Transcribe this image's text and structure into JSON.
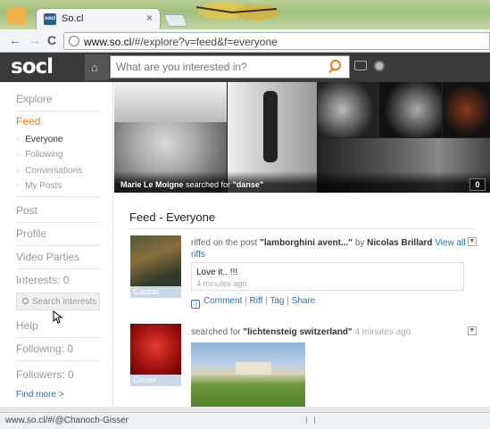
{
  "browser": {
    "tab_title": "So.cl",
    "tab_close": "×",
    "url_domain": "www.so.cl",
    "url_rest": "/#/explore?v=feed&f=everyone",
    "back": "←",
    "forward": "→",
    "reload": "C"
  },
  "header": {
    "logo": "socl",
    "search_placeholder": "What are you interested in?"
  },
  "sidebar": {
    "explore": "Explore",
    "feed": "Feed",
    "feed_items": [
      "Everyone",
      "Following",
      "Conversations",
      "My Posts"
    ],
    "post": "Post",
    "profile": "Profile",
    "video_parties": "Video Parties",
    "interests": "Interests: 0",
    "search_interests": "Search interests",
    "help": "Help",
    "following": "Following: 0",
    "followers": "Followers: 0",
    "find_more": "Find more >"
  },
  "banner": {
    "user": "Marie Le Moigne",
    "searched_for": "searched for",
    "query": "\"danse\"",
    "count": "0"
  },
  "feed": {
    "title": "Feed - Everyone",
    "post1": {
      "avatar_name": "Gaurav",
      "prefix": "riffed on the post ",
      "post_title": "\"lamborghini avent...\"",
      "by": " by ",
      "author": "Nicolas Brillard",
      "view_all": "View all riffs",
      "comment": "Love it.. !!!",
      "comment_time": "4 minutes ago",
      "actions": [
        "Comment",
        "Riff",
        "Tag",
        "Share"
      ],
      "sep": "|"
    },
    "post2": {
      "avatar_name": "Gisser",
      "prefix": "searched for ",
      "query": "\"lichtensteig switzerland\"",
      "time": " 4 minutes ago"
    }
  },
  "status": {
    "url": "www.so.cl/#/@Chanoch-Gisser"
  },
  "colors": {
    "accent": "#e77b1b",
    "link": "#2a6fb6",
    "header_bg": "#3a3a3a"
  }
}
